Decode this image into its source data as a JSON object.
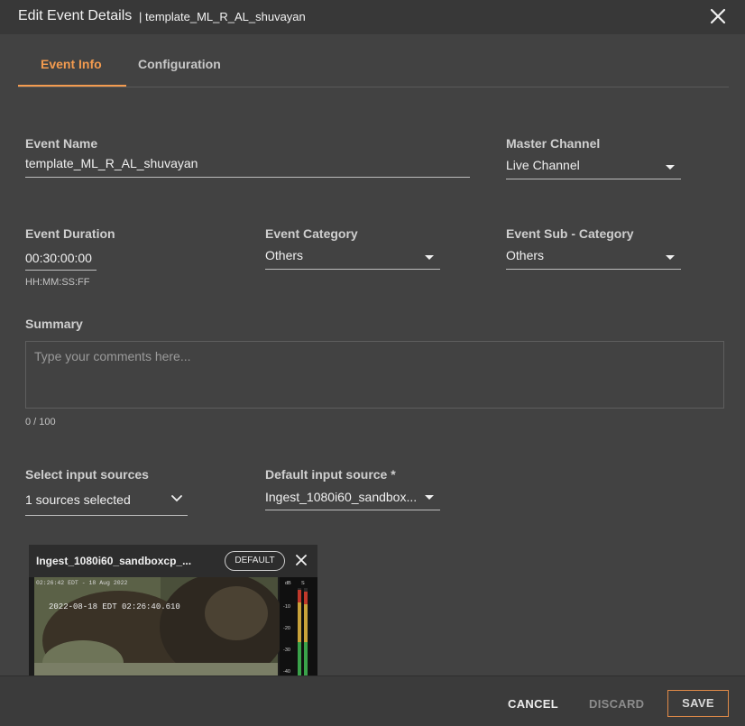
{
  "dialog": {
    "title": "Edit Event Details",
    "subtitle": "| template_ML_R_AL_shuvayan",
    "close_icon": "close-icon"
  },
  "tabs": [
    {
      "label": "Event Info",
      "active": true
    },
    {
      "label": "Configuration",
      "active": false
    }
  ],
  "form": {
    "event_name": {
      "label": "Event Name",
      "value": "template_ML_R_AL_shuvayan"
    },
    "master_channel": {
      "label": "Master Channel",
      "value": "Live Channel"
    },
    "event_duration": {
      "label": "Event Duration",
      "value": "00:30:00:00",
      "hint": "HH:MM:SS:FF"
    },
    "event_category": {
      "label": "Event Category",
      "value": "Others"
    },
    "event_sub_category": {
      "label": "Event Sub - Category",
      "value": "Others"
    },
    "summary": {
      "label": "Summary",
      "placeholder": "Type your comments here...",
      "counter": "0 / 100"
    },
    "input_sources": {
      "label": "Select input sources",
      "value": "1 sources selected"
    },
    "default_source": {
      "label": "Default input source *",
      "value": "Ingest_1080i60_sandbox..."
    }
  },
  "source_card": {
    "title": "Ingest_1080i60_sandboxcp_...",
    "badge": "DEFAULT",
    "video": {
      "overlay_top": "02:26:42 EDT - 18 Aug 2022",
      "overlay_timecode": "2022-08-18 EDT 02:26:40.610",
      "meter_labels": [
        "dB",
        "S",
        "-10",
        "-20",
        "-30",
        "-40"
      ]
    }
  },
  "footer": {
    "cancel": "CANCEL",
    "discard": "DISCARD",
    "save": "SAVE"
  },
  "colors": {
    "accent": "#f39b4f",
    "background": "#424242",
    "titlebar": "#383838"
  }
}
